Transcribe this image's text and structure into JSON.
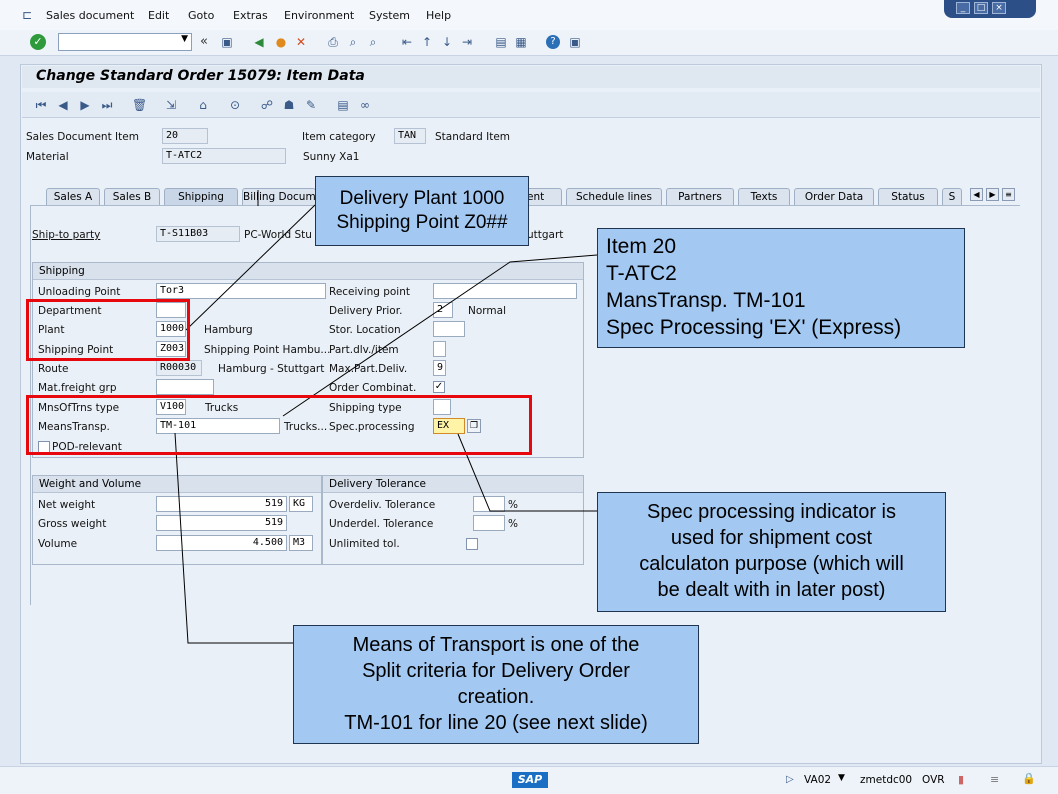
{
  "menu": {
    "items": [
      "Sales document",
      "Edit",
      "Goto",
      "Extras",
      "Environment",
      "System",
      "Help"
    ]
  },
  "window_controls": {
    "minimize": "_",
    "restore": "□",
    "close": "×"
  },
  "toolbar": {
    "back_glyph": "«"
  },
  "title": "Change Standard Order 15079: Item Data",
  "header": {
    "item_label": "Sales Document Item",
    "item_value": "20",
    "material_label": "Material",
    "material_value": "T-ATC2",
    "item_category_label": "Item category",
    "item_category_value": "TAN",
    "item_category_text": "Standard Item",
    "material_desc": "Sunny Xa1"
  },
  "tabs": [
    "Sales A",
    "Sales B",
    "Shipping",
    "Billing Docum",
    "ent",
    "Schedule lines",
    "Partners",
    "Texts",
    "Order Data",
    "Status",
    "S"
  ],
  "shipto": {
    "label": "Ship-to party",
    "value": "T-S11B03",
    "name": "PC-World Stu",
    "city": "uttgart"
  },
  "shipping": {
    "title": "Shipping",
    "unloading_point_label": "Unloading Point",
    "unloading_point_value": "Tor3",
    "receiving_point_label": "Receiving point",
    "receiving_point_value": "",
    "department_label": "Department",
    "department_value": "",
    "delivery_prior_label": "Delivery Prior.",
    "delivery_prior_value": "2",
    "delivery_prior_text": "Normal",
    "plant_label": "Plant",
    "plant_value": "1000",
    "plant_text": "Hamburg",
    "stor_location_label": "Stor. Location",
    "stor_location_value": "",
    "shipping_point_label": "Shipping Point",
    "shipping_point_value": "Z003",
    "shipping_point_text": "Shipping Point Hambu...",
    "part_dlv_label": "Part.dlv./item",
    "part_dlv_value": "",
    "route_label": "Route",
    "route_value": "R00030",
    "route_text": "Hamburg - Stuttgart",
    "max_part_deliv_label": "Max.Part.Deliv.",
    "max_part_deliv_value": "9",
    "mat_freight_label": "Mat.freight grp",
    "mat_freight_value": "",
    "order_combinat_label": "Order Combinat.",
    "order_combinat_checked": "✓",
    "mns_of_trns_label": "MnsOfTrns type",
    "mns_of_trns_value": "V100",
    "mns_of_trns_text": "Trucks",
    "shipping_type_label": "Shipping type",
    "shipping_type_value": "",
    "means_transp_label": "MeansTransp.",
    "means_transp_value": "TM-101",
    "means_transp_text": "Trucks...",
    "spec_processing_label": "Spec.processing",
    "spec_processing_value": "EX",
    "pod_relevant_label": "POD-relevant"
  },
  "weight": {
    "title": "Weight and Volume",
    "net_weight_label": "Net weight",
    "net_weight_value": "519",
    "net_weight_unit": "KG",
    "gross_weight_label": "Gross weight",
    "gross_weight_value": "519",
    "volume_label": "Volume",
    "volume_value": "4.500",
    "volume_unit": "M3"
  },
  "tolerance": {
    "title": "Delivery Tolerance",
    "overdeliv_label": "Overdeliv. Tolerance",
    "pct1": "%",
    "underdel_label": "Underdel. Tolerance",
    "pct2": "%",
    "unlimited_label": "Unlimited tol."
  },
  "callouts": {
    "plant_line1": "Delivery Plant 1000",
    "plant_line2": "Shipping Point Z0##",
    "item_line1": "Item 20",
    "item_line2": "T-ATC2",
    "item_line3": "MansTransp. TM-101",
    "item_line4": "Spec Processing 'EX' (Express)",
    "spec_line1": "Spec processing indicator is",
    "spec_line2": "used for shipment cost",
    "spec_line3": "calculaton purpose (which will",
    "spec_line4": "be dealt with in later post)",
    "means_line1": "Means of Transport is one of the",
    "means_line2": "Split criteria for Delivery Order",
    "means_line3": "creation.",
    "means_line4": "TM-101 for line 20 (see next slide)"
  },
  "status": {
    "logo": "SAP",
    "transaction": "VA02",
    "server": "zmetdc00",
    "mode": "OVR"
  }
}
